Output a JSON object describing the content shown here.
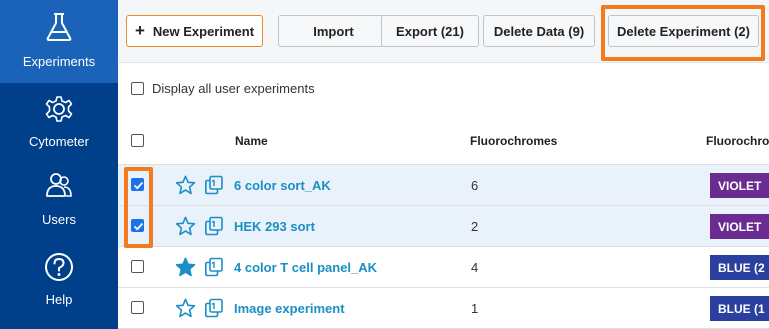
{
  "sidebar": {
    "items": [
      {
        "label": "Experiments",
        "icon": "flask-icon"
      },
      {
        "label": "Cytometer",
        "icon": "gear-icon"
      },
      {
        "label": "Users",
        "icon": "users-icon"
      },
      {
        "label": "Help",
        "icon": "help-icon"
      }
    ]
  },
  "toolbar": {
    "new_experiment": "New Experiment",
    "import": "Import",
    "export": "Export (21)",
    "delete_data": "Delete Data (9)",
    "delete_experiment": "Delete Experiment (2)"
  },
  "display_all": "Display all user experiments",
  "table": {
    "headers": {
      "name": "Name",
      "fluorochromes": "Fluorochromes",
      "fluorochrome_panel": "Fluorochron"
    },
    "rows": [
      {
        "checked": true,
        "starred": false,
        "name": "6 color sort_AK",
        "count": "6",
        "chip": "VIOLET",
        "chip_color": "#6a2c91"
      },
      {
        "checked": true,
        "starred": false,
        "name": "HEK 293 sort",
        "count": "2",
        "chip": "VIOLET",
        "chip_color": "#6a2c91"
      },
      {
        "checked": false,
        "starred": true,
        "name": "4 color T cell panel_AK",
        "count": "4",
        "chip": "BLUE (2",
        "chip_color": "#2b3f9e"
      },
      {
        "checked": false,
        "starred": false,
        "name": "Image experiment",
        "count": "1",
        "chip": "BLUE (1",
        "chip_color": "#2b3f9e"
      }
    ]
  },
  "colors": {
    "sidebar": "#003f8a",
    "sidebar_active": "#1b63b8",
    "highlight": "#f47a20",
    "link": "#1a8fc4",
    "star": "#1a8fc4"
  }
}
